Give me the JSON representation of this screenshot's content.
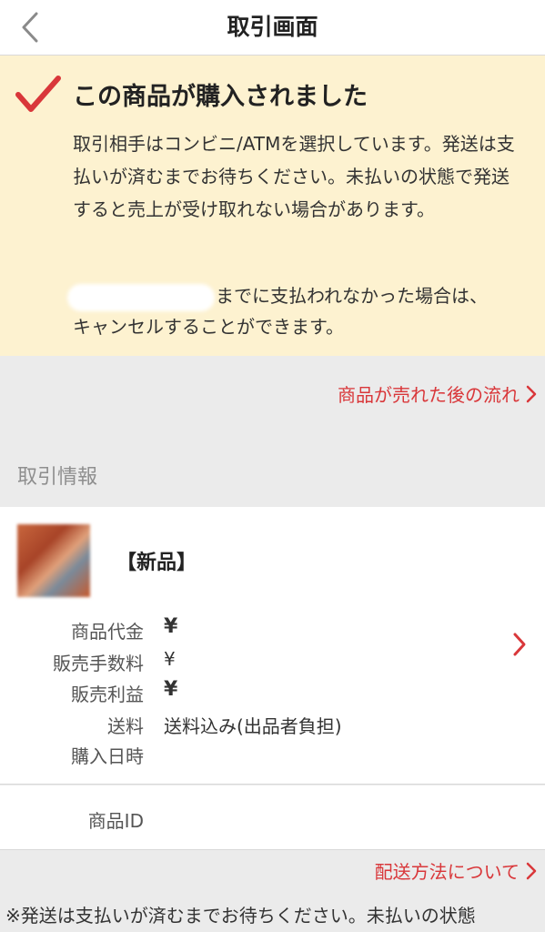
{
  "navbar": {
    "back_icon": "chevron-left-icon",
    "title": "取引画面"
  },
  "notice": {
    "icon": "checkmark-icon",
    "accent_color": "#d9373a",
    "background": "#fdf2d0",
    "title": "この商品が購入されました",
    "body": "取引相手はコンビニ/ATMを選択しています。発送は支払いが済むまでお待ちください。未払いの状態で発送すると売上が受け取れない場合があります。",
    "deadline_line1": "までに支払われなかった場合は、",
    "deadline_line2": "キャンセルすることができます。"
  },
  "links": {
    "flow": "商品が売れた後の流れ",
    "shipping": "配送方法について"
  },
  "transaction": {
    "section_label": "取引情報",
    "product_name": "【新品】",
    "rows": [
      {
        "label": "商品代金",
        "value": "¥"
      },
      {
        "label": "販売手数料",
        "value": "¥"
      },
      {
        "label": "販売利益",
        "value": "¥"
      },
      {
        "label": "送料",
        "value": "送料込み(出品者負担)"
      },
      {
        "label": "購入日時",
        "value": ""
      }
    ],
    "product_id_label": "商品ID"
  },
  "footer": {
    "note": "※発送は支払いが済むまでお待ちください。未払いの状態"
  }
}
